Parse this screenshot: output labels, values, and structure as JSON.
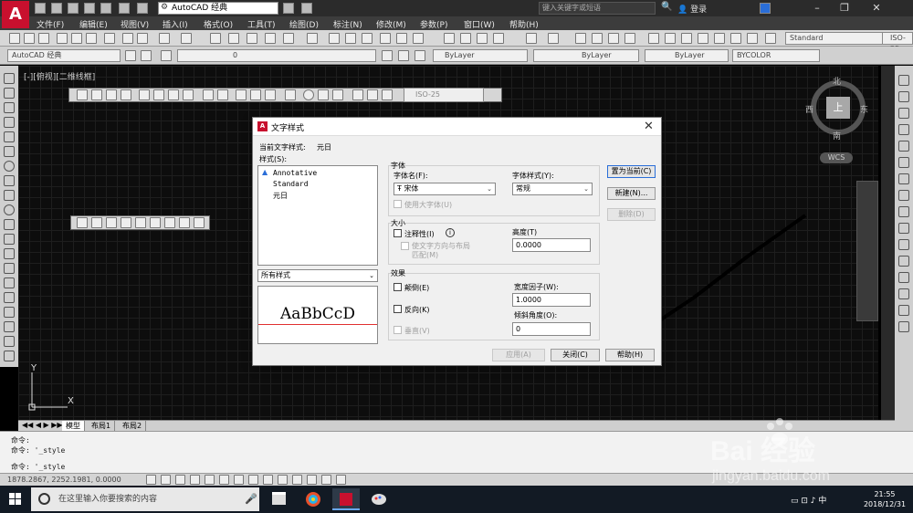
{
  "titlebar": {
    "workspace": "AutoCAD 经典",
    "window_title": "",
    "search_placeholder": "键入关键字或短语",
    "login": "登录"
  },
  "menu": [
    "文件(F)",
    "编辑(E)",
    "视图(V)",
    "插入(I)",
    "格式(O)",
    "工具(T)",
    "绘图(D)",
    "标注(N)",
    "修改(M)",
    "参数(P)",
    "窗口(W)",
    "帮助(H)"
  ],
  "toolbar1": {
    "dim_style": "Standard",
    "dim_style2": "ISO-25"
  },
  "toolbar2": {
    "workspace": "AutoCAD 经典",
    "layer": "0",
    "color": "ByLayer",
    "linetype": "ByLayer",
    "lineweight": "ByLayer",
    "plotstyle": "BYCOLOR"
  },
  "viewport_label": "[-][俯视][二维线框]",
  "dim_toolbar_style": "ISO-25",
  "viewcube": {
    "north": "北",
    "south": "南",
    "east": "东",
    "west": "西",
    "top": "上",
    "wcs": "WCS"
  },
  "ucs": {
    "x": "X",
    "y": "Y"
  },
  "layout_tabs": [
    "模型",
    "布局1",
    "布局2"
  ],
  "command_lines": [
    "命令:",
    "命令: '_style",
    "命令: '_style"
  ],
  "coords": "1878.2867, 2252.1981, 0.0000",
  "dialog": {
    "title": "文字样式",
    "current_style_label": "当前文字样式:",
    "current_style": "元日",
    "styles_label": "样式(S):",
    "styles": [
      "Annotative",
      "Standard",
      "元日"
    ],
    "filter": "所有样式",
    "preview": "AaBbCcD",
    "font_group": "字体",
    "font_name_label": "字体名(F):",
    "font_name": "宋体",
    "font_style_label": "字体样式(Y):",
    "font_style": "常规",
    "use_bigfont": "使用大字体(U)",
    "size_group": "大小",
    "annotative": "注释性(I)",
    "match_orientation": "使文字方向与布局",
    "match_orientation2": "匹配(M)",
    "height_label": "高度(T)",
    "height": "0.0000",
    "effects_group": "效果",
    "upside_down": "颠倒(E)",
    "backwards": "反向(K)",
    "vertical": "垂直(V)",
    "width_factor_label": "宽度因子(W):",
    "width_factor": "1.0000",
    "oblique_label": "倾斜角度(O):",
    "oblique": "0",
    "btn_set_current": "置为当前(C)",
    "btn_new": "新建(N)...",
    "btn_delete": "删除(D)",
    "btn_apply": "应用(A)",
    "btn_close": "关闭(C)",
    "btn_help": "帮助(H)"
  },
  "taskbar": {
    "search_placeholder": "在这里输入你要搜索的内容",
    "time": "21:55",
    "date": "2018/12/31"
  },
  "watermark": {
    "brand": "Bai 经验",
    "url": "jingyan.baidu.com"
  },
  "colors": {
    "accent": "#2a6ed8",
    "autocad_red": "#c8102e",
    "preview_baseline": "#e03030"
  }
}
